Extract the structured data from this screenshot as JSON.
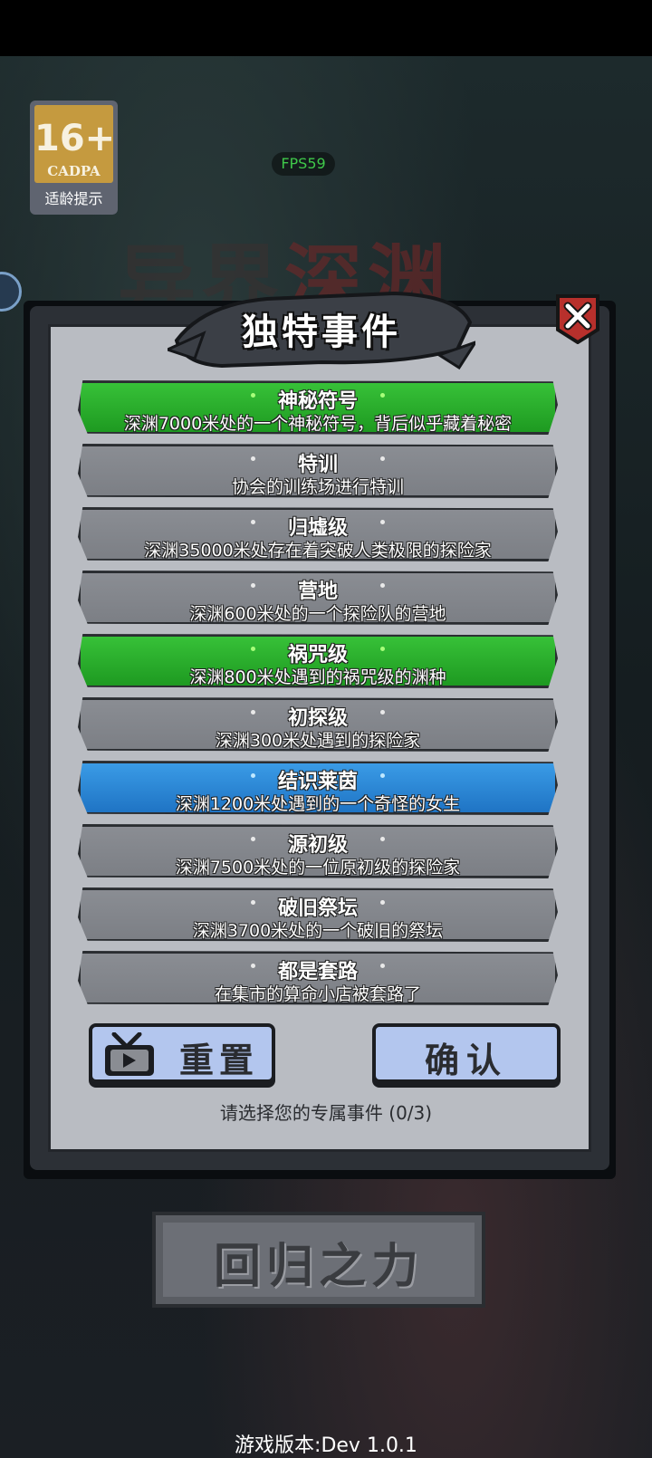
{
  "hud": {
    "age_rating": "16+",
    "age_org": "CADPA",
    "age_tip": "适龄提示",
    "fps": "FPS59"
  },
  "background": {
    "title_part1": "异界",
    "title_part2": "深渊"
  },
  "dialog": {
    "title": "独特事件",
    "close_icon": "close-icon",
    "events": [
      {
        "title": "神秘符号",
        "desc": "深渊7000米处的一个神秘符号，背后似乎藏着秘密",
        "color": "green"
      },
      {
        "title": "特训",
        "desc": "协会的训练场进行特训",
        "color": "gray"
      },
      {
        "title": "归墟级",
        "desc": "深渊35000米处存在着突破人类极限的探险家",
        "color": "gray"
      },
      {
        "title": "营地",
        "desc": "深渊600米处的一个探险队的营地",
        "color": "gray"
      },
      {
        "title": "祸咒级",
        "desc": "深渊800米处遇到的祸咒级的渊种",
        "color": "green"
      },
      {
        "title": "初探级",
        "desc": "深渊300米处遇到的探险家",
        "color": "gray"
      },
      {
        "title": "结识莱茵",
        "desc": "深渊1200米处遇到的一个奇怪的女生",
        "color": "blue"
      },
      {
        "title": "源初级",
        "desc": "深渊7500米处的一位原初级的探险家",
        "color": "gray"
      },
      {
        "title": "破旧祭坛",
        "desc": "深渊3700米处的一个破旧的祭坛",
        "color": "gray"
      },
      {
        "title": "都是套路",
        "desc": "在集市的算命小店被套路了",
        "color": "gray"
      }
    ],
    "reset_label": "重置",
    "reset_icon": "tv-ad-icon",
    "confirm_label": "确认",
    "hint": "请选择您的专属事件 (0/3)"
  },
  "footer": {
    "return_label": "回归之力",
    "version": "游戏版本:Dev 1.0.1"
  },
  "colors": {
    "green": "#2bb02d",
    "blue": "#2a86d8",
    "gray": "#84878d",
    "button": "#b3c6ee"
  }
}
